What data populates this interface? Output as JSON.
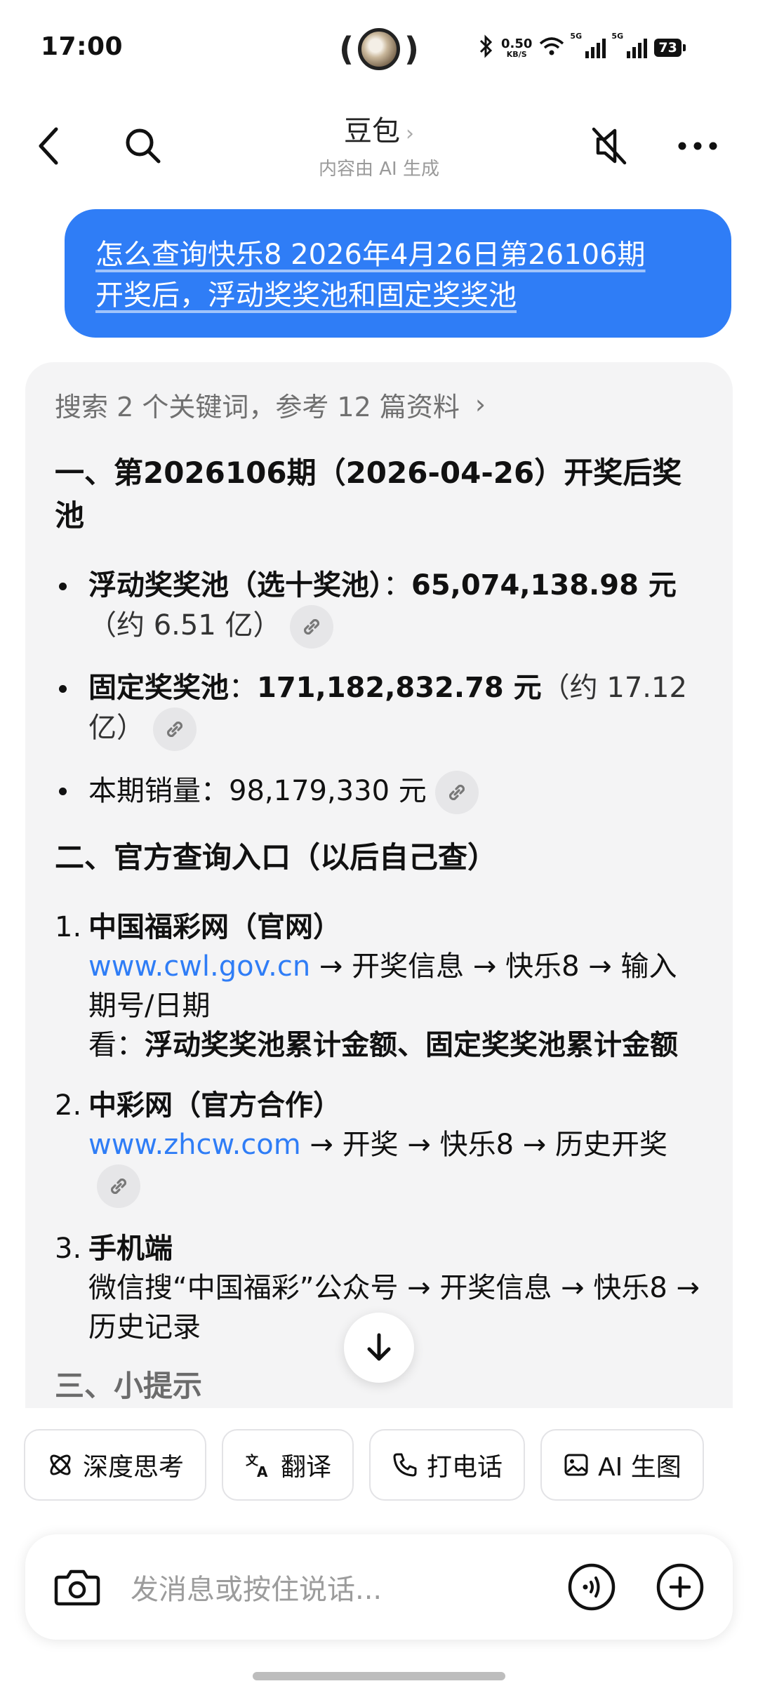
{
  "status_bar": {
    "time": "17:00",
    "net_speed_value": "0.50",
    "net_speed_unit": "KB/S",
    "signal1_label": "5G",
    "signal2_label": "5G",
    "battery": "73",
    "icons": [
      "bluetooth-icon",
      "wifi-icon",
      "signal-icon",
      "battery-icon"
    ]
  },
  "header": {
    "title": "豆包",
    "title_chevron": "›",
    "subtitle": "内容由 AI 生成"
  },
  "user_message": {
    "line1": "怎么查询快乐8 2026年4月26日第26106期",
    "line2": "开奖后，浮动奖奖池和固定奖奖池"
  },
  "answer": {
    "search_note": "搜索 2 个关键词，参考 12 篇资料",
    "section1_title": "一、第2026106期（2026-04-26）开奖后奖池",
    "bullets": [
      {
        "label": "浮动奖奖池（选十奖池）",
        "sep": "：",
        "value": "65,074,138.98 元",
        "note": "（约 6.51 亿）"
      },
      {
        "label": "固定奖奖池",
        "sep": "：",
        "value": "171,182,832.78 元",
        "note": "（约 17.12 亿）"
      },
      {
        "label": "本期销量",
        "sep": "：",
        "value": "98,179,330 元",
        "note": ""
      }
    ],
    "section2_title": "二、官方查询入口（以后自己查）",
    "entries": [
      {
        "num": "1.",
        "title": "中国福彩网（官网）",
        "link": "www.cwl.gov.cn",
        "path": " → 开奖信息 → 快乐8 → 输入期号/日期",
        "look_label": "看：",
        "look_text": "浮动奖奖池累计金额、固定奖奖池累计金额"
      },
      {
        "num": "2.",
        "title": "中彩网（官方合作）",
        "link": "www.zhcw.com",
        "path": " → 开奖 → 快乐8 → 历史开奖"
      },
      {
        "num": "3.",
        "title": "手机端",
        "path": "微信搜“中国福彩”公众号 → 开奖信息 → 快乐8 → 历史记录"
      }
    ],
    "section3_partial": "三、小提示"
  },
  "chips": [
    "深度思考",
    "翻译",
    "打电话",
    "AI 生图"
  ],
  "composer": {
    "placeholder": "发消息或按住说话..."
  },
  "colors": {
    "accent": "#2f7df6",
    "card_bg": "#f4f4f5"
  }
}
